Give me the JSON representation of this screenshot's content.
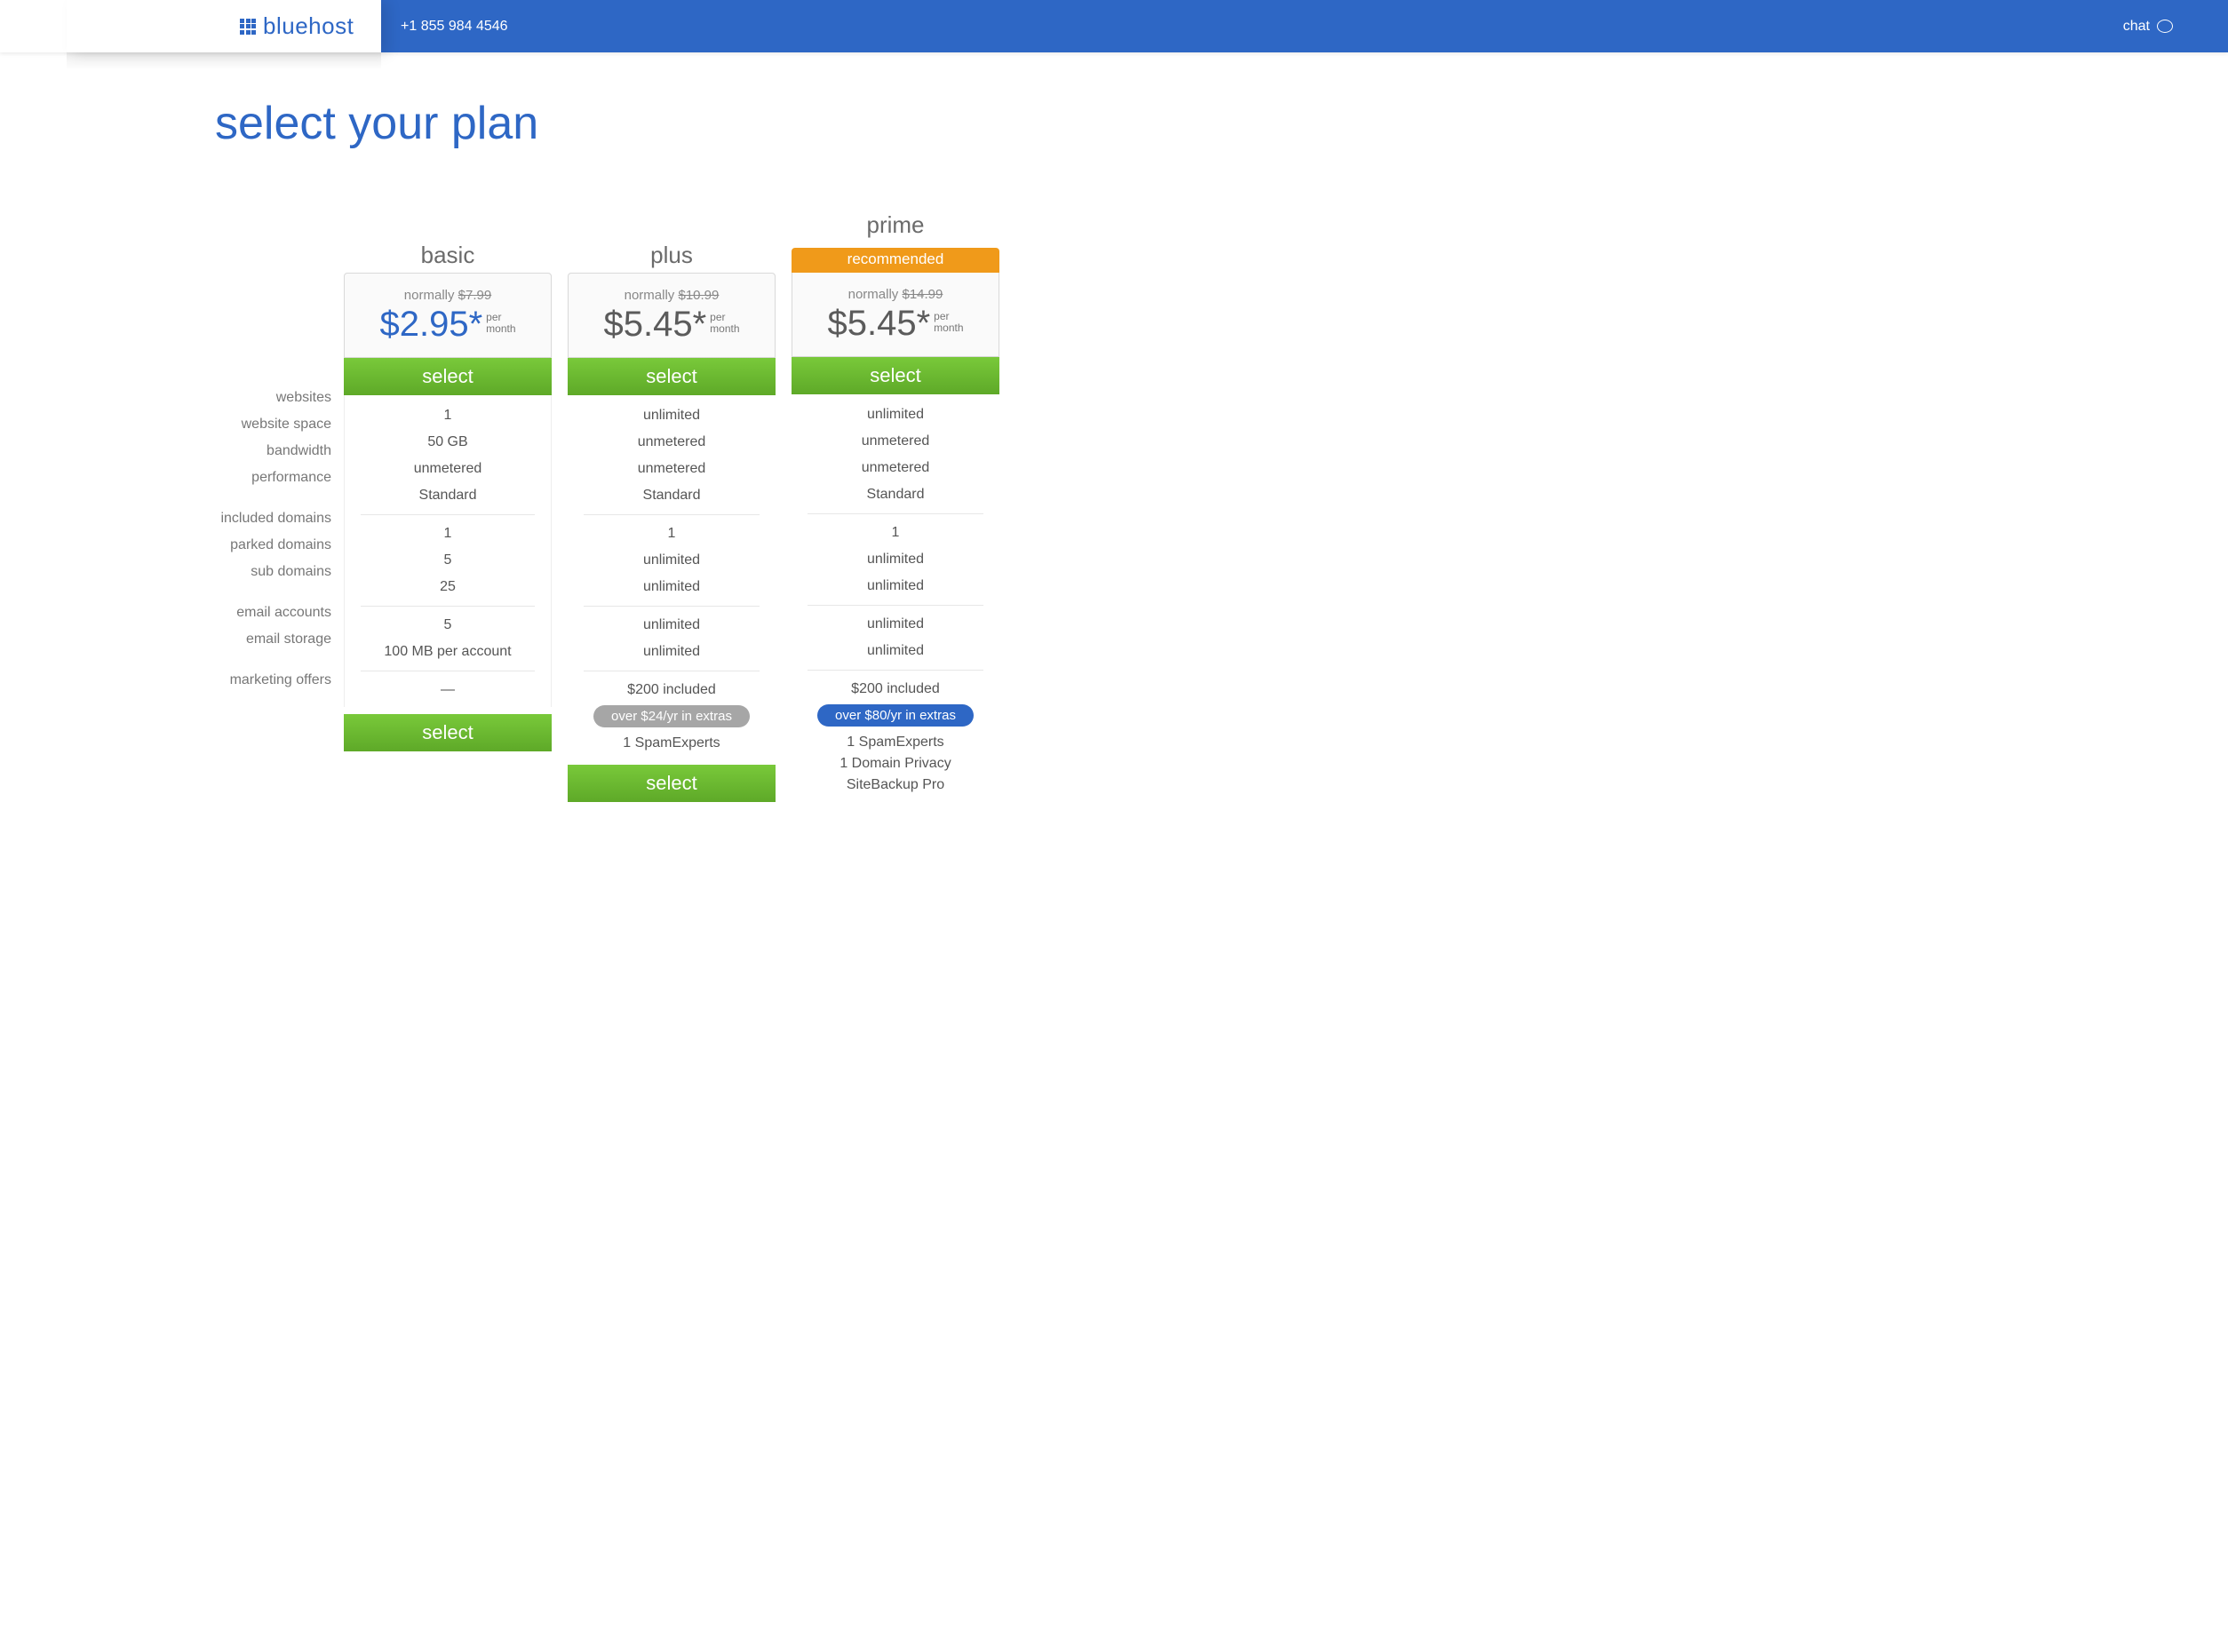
{
  "header": {
    "brand": "bluehost",
    "phone": "+1 855 984 4546",
    "chat_label": "chat"
  },
  "page": {
    "title": "select your plan",
    "select_label": "select",
    "per_month_line1": "per",
    "per_month_line2": "month",
    "normally_prefix": "normally",
    "recommended_label": "recommended",
    "feature_labels": [
      "websites",
      "website space",
      "bandwidth",
      "performance",
      "included domains",
      "parked domains",
      "sub domains",
      "email accounts",
      "email storage",
      "marketing offers"
    ]
  },
  "plans": [
    {
      "name": "basic",
      "normal_price": "$7.99",
      "price": "$2.95*",
      "price_color": "blue",
      "features": [
        "1",
        "50 GB",
        "unmetered",
        "Standard",
        "1",
        "5",
        "25",
        "5",
        "100 MB per account",
        "—"
      ],
      "extras_note": "",
      "extras_color": "",
      "extras": []
    },
    {
      "name": "plus",
      "normal_price": "$10.99",
      "price": "$5.45*",
      "price_color": "grey",
      "features": [
        "unlimited",
        "unmetered",
        "unmetered",
        "Standard",
        "1",
        "unlimited",
        "unlimited",
        "unlimited",
        "unlimited",
        "$200 included"
      ],
      "extras_note": "over $24/yr in extras",
      "extras_color": "grey",
      "extras": [
        "1 SpamExperts"
      ]
    },
    {
      "name": "prime",
      "recommended": true,
      "normal_price": "$14.99",
      "price": "$5.45*",
      "price_color": "grey",
      "features": [
        "unlimited",
        "unmetered",
        "unmetered",
        "Standard",
        "1",
        "unlimited",
        "unlimited",
        "unlimited",
        "unlimited",
        "$200 included"
      ],
      "extras_note": "over $80/yr in extras",
      "extras_color": "blue",
      "extras": [
        "1 SpamExperts",
        "1 Domain Privacy",
        "SiteBackup Pro"
      ]
    }
  ]
}
